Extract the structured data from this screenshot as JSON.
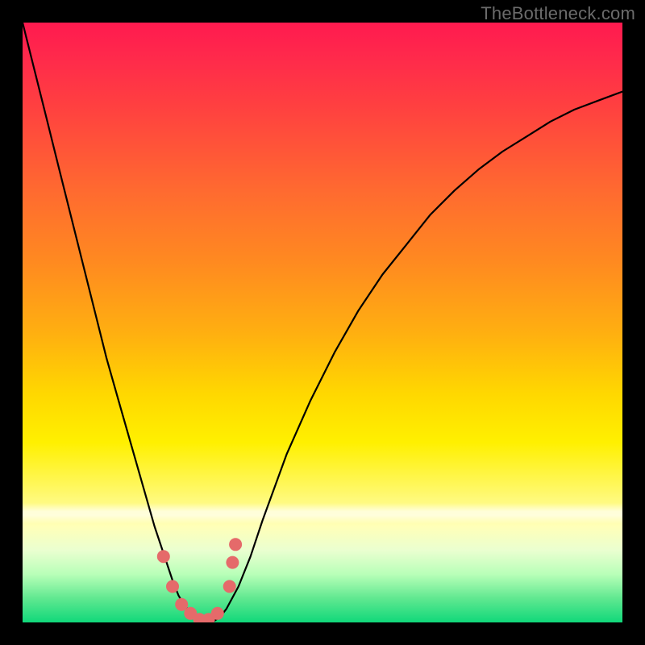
{
  "watermark": "TheBottleneck.com",
  "chart_data": {
    "type": "line",
    "title": "",
    "xlabel": "",
    "ylabel": "",
    "xlim": [
      0,
      100
    ],
    "ylim": [
      0,
      100
    ],
    "grid": false,
    "gradient_stops": [
      {
        "pos": 0,
        "color": "#ff1a4f"
      },
      {
        "pos": 14,
        "color": "#ff4040"
      },
      {
        "pos": 40,
        "color": "#ff8a20"
      },
      {
        "pos": 70,
        "color": "#fff000"
      },
      {
        "pos": 88,
        "color": "#eaffd0"
      },
      {
        "pos": 100,
        "color": "#10d87a"
      }
    ],
    "series": [
      {
        "name": "bottleneck-curve",
        "stroke": "#000000",
        "x": [
          0,
          2,
          4,
          6,
          8,
          10,
          12,
          14,
          16,
          18,
          20,
          22,
          24,
          25,
          26,
          27,
          28,
          29,
          30,
          31,
          32,
          33,
          34,
          36,
          38,
          40,
          44,
          48,
          52,
          56,
          60,
          64,
          68,
          72,
          76,
          80,
          84,
          88,
          92,
          96,
          100
        ],
        "y": [
          100,
          92,
          84,
          76,
          68,
          60,
          52,
          44,
          37,
          30,
          23,
          16,
          10,
          7,
          4.5,
          2.8,
          1.6,
          0.8,
          0.3,
          0.1,
          0.3,
          1.0,
          2.3,
          6,
          11,
          17,
          28,
          37,
          45,
          52,
          58,
          63,
          68,
          72,
          75.5,
          78.5,
          81,
          83.5,
          85.5,
          87,
          88.5
        ]
      }
    ],
    "markers": {
      "color": "#e56a6a",
      "points": [
        {
          "x": 23.5,
          "y": 11
        },
        {
          "x": 25.0,
          "y": 6
        },
        {
          "x": 26.5,
          "y": 3
        },
        {
          "x": 28.0,
          "y": 1.5
        },
        {
          "x": 29.5,
          "y": 0.5
        },
        {
          "x": 31.0,
          "y": 0.5
        },
        {
          "x": 32.5,
          "y": 1.5
        },
        {
          "x": 34.5,
          "y": 6
        },
        {
          "x": 35.0,
          "y": 10
        },
        {
          "x": 35.5,
          "y": 13
        }
      ],
      "radius": 8
    }
  }
}
